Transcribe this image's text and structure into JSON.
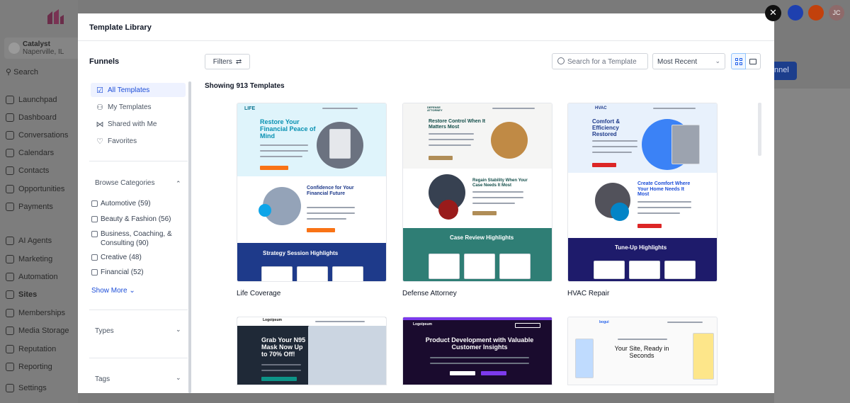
{
  "background": {
    "location": {
      "name": "Catalyst",
      "city": "Naperville, IL"
    },
    "search_label": "Search",
    "nav": [
      {
        "label": "Launchpad",
        "icon": "rocket-icon"
      },
      {
        "label": "Dashboard",
        "icon": "dashboard-icon"
      },
      {
        "label": "Conversations",
        "icon": "chat-icon"
      },
      {
        "label": "Calendars",
        "icon": "calendar-icon"
      },
      {
        "label": "Contacts",
        "icon": "contacts-icon"
      },
      {
        "label": "Opportunities",
        "icon": "opportunities-icon"
      },
      {
        "label": "Payments",
        "icon": "payments-icon"
      },
      {
        "label": "AI Agents",
        "icon": "ai-icon"
      },
      {
        "label": "Marketing",
        "icon": "send-icon"
      },
      {
        "label": "Automation",
        "icon": "automation-icon"
      },
      {
        "label": "Sites",
        "icon": "sites-icon"
      },
      {
        "label": "Memberships",
        "icon": "memberships-icon"
      },
      {
        "label": "Media Storage",
        "icon": "media-icon"
      },
      {
        "label": "Reputation",
        "icon": "star-icon"
      },
      {
        "label": "Reporting",
        "icon": "reporting-icon"
      },
      {
        "label": "Settings",
        "icon": "gear-icon"
      }
    ],
    "avatar_initials": "JC",
    "primary_button_label": "nnel"
  },
  "modal": {
    "title": "Template Library",
    "funnels_label": "Funnels",
    "filters": [
      {
        "label": "All Templates",
        "icon": "checkbox-icon",
        "selected": true
      },
      {
        "label": "My Templates",
        "icon": "user-icon",
        "selected": false
      },
      {
        "label": "Shared with Me",
        "icon": "share-icon",
        "selected": false
      },
      {
        "label": "Favorites",
        "icon": "heart-icon",
        "selected": false
      }
    ],
    "browse_categories_label": "Browse Categories",
    "categories": [
      {
        "label": "Automotive (59)"
      },
      {
        "label": "Beauty & Fashion (56)"
      },
      {
        "label": "Business, Coaching, & Consulting (90)"
      },
      {
        "label": "Creative (48)"
      },
      {
        "label": "Financial (52)"
      }
    ],
    "show_more_label": "Show More",
    "types_label": "Types",
    "tags_label": "Tags",
    "filters_button_label": "Filters",
    "search_placeholder": "Search for a Template",
    "sort_value": "Most Recent",
    "showing_text": "Showing 913 Templates",
    "templates": [
      {
        "name": "Life Coverage",
        "logo": "LIFE",
        "hero_title": "Restore Your Financial Peace of Mind",
        "section_title": "Confidence for Your Financial Future",
        "band_title": "Strategy Session Highlights"
      },
      {
        "name": "Defense Attorney",
        "logo": "DEFENSE ATTORNEY",
        "hero_title": "Restore Control When It Matters Most",
        "section_title": "Regain Stability When Your Case Needs It Most",
        "band_title": "Case Review Highlights"
      },
      {
        "name": "HVAC Repair",
        "logo": "HVAC",
        "hero_title": "Comfort & Efficiency Restored",
        "section_title": "Create Comfort Where Your Home Needs It Most",
        "band_title": "Tune-Up Highlights"
      },
      {
        "logo": "Logoipsum",
        "hero_title": "Grab Your N95 Mask Now Up to 70% Off!"
      },
      {
        "logo": "Logoipsum",
        "hero_title": "Product Development with Valuable Customer Insights"
      },
      {
        "logo": "bogui",
        "hero_title": "Your Site, Ready in Seconds"
      }
    ]
  }
}
